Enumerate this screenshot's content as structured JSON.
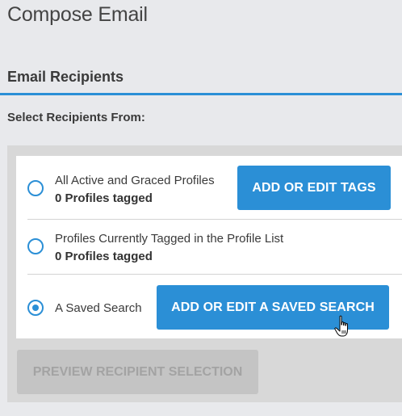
{
  "page": {
    "title": "Compose Email"
  },
  "recipients": {
    "section_title": "Email Recipients",
    "select_label": "Select Recipients From:",
    "options": [
      {
        "title": "All Active and Graced Profiles",
        "subtitle": "0 Profiles tagged",
        "selected": false,
        "button": "ADD OR EDIT TAGS"
      },
      {
        "title": "Profiles Currently Tagged in the Profile List",
        "subtitle": "0 Profiles tagged",
        "selected": false
      },
      {
        "title": "A Saved Search",
        "selected": true,
        "button": "ADD OR EDIT A SAVED SEARCH"
      }
    ],
    "preview_button": "PREVIEW RECIPIENT SELECTION"
  },
  "colors": {
    "accent": "#2b8fd6",
    "disabled": "#c4c4c4"
  },
  "icons": {
    "cursor": "hand-pointer-icon"
  }
}
